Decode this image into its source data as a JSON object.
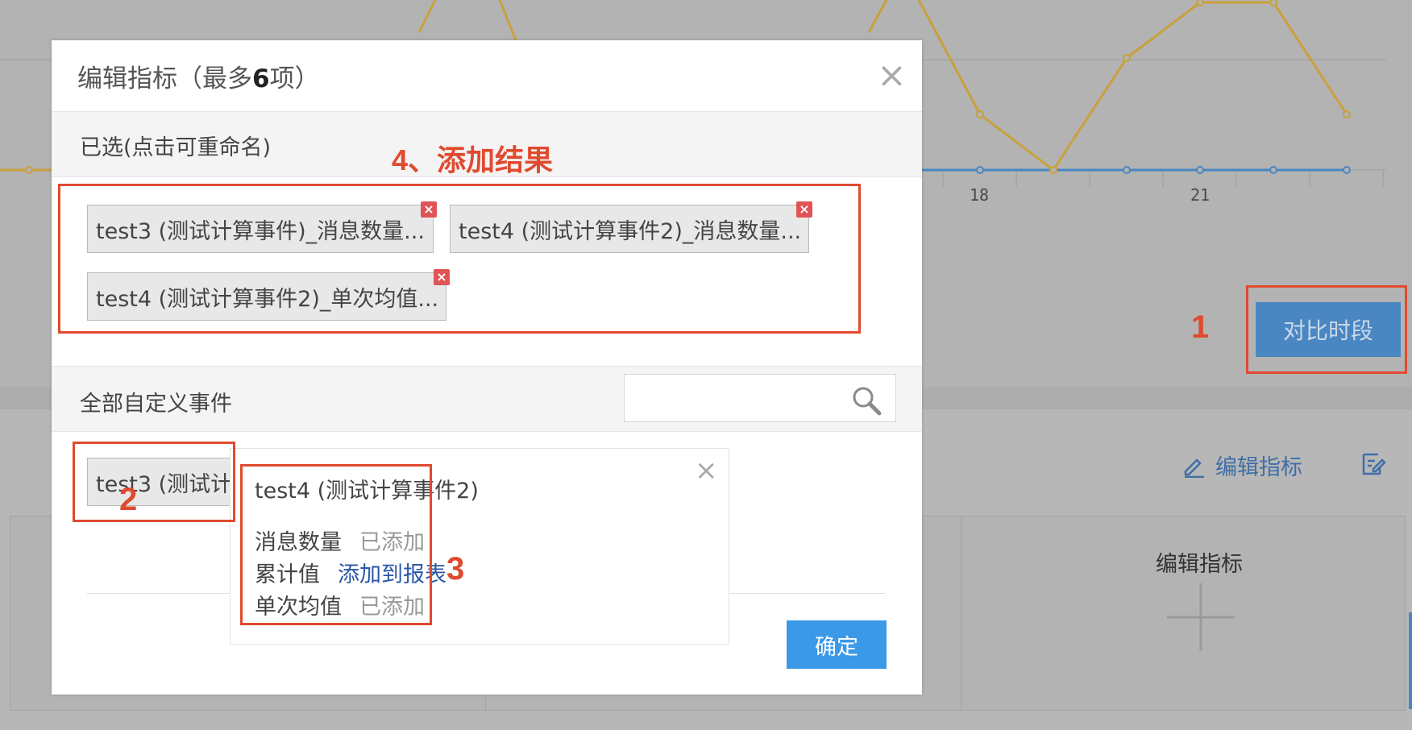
{
  "modal": {
    "title_prefix": "编辑指标（最多",
    "title_count": "6",
    "title_suffix": "项）",
    "selected_section_label": "已选(点击可重命名)",
    "selected_tags": [
      {
        "label": "test3 (测试计算事件)_消息数量..."
      },
      {
        "label": "test4 (测试计算事件2)_消息数量..."
      },
      {
        "label": "test4 (测试计算事件2)_单次均值..."
      }
    ],
    "all_events_section_label": "全部自定义事件",
    "search_placeholder": "",
    "event_items": [
      {
        "label": "test3 (测试计"
      }
    ],
    "popover": {
      "title": "test4 (测试计算事件2)",
      "rows": [
        {
          "metric": "消息数量",
          "status": "已添加",
          "added": true
        },
        {
          "metric": "累计值",
          "status": "添加到报表",
          "added": false
        },
        {
          "metric": "单次均值",
          "status": "已添加",
          "added": true
        }
      ]
    },
    "confirm_label": "确定",
    "close_glyph": "×"
  },
  "background": {
    "compare_button_label": "对比时段",
    "edit_metrics_link": "编辑指标",
    "edit_metrics_card_title": "编辑指标",
    "x_ticks": [
      "18",
      "21"
    ],
    "line_colors": {
      "gold": "#c9a03b",
      "blue": "#4a86c2"
    }
  },
  "annotations": {
    "step1": "1",
    "step2": "2",
    "step3": "3",
    "step4": "4、添加结果",
    "color": "#e04a2f"
  }
}
